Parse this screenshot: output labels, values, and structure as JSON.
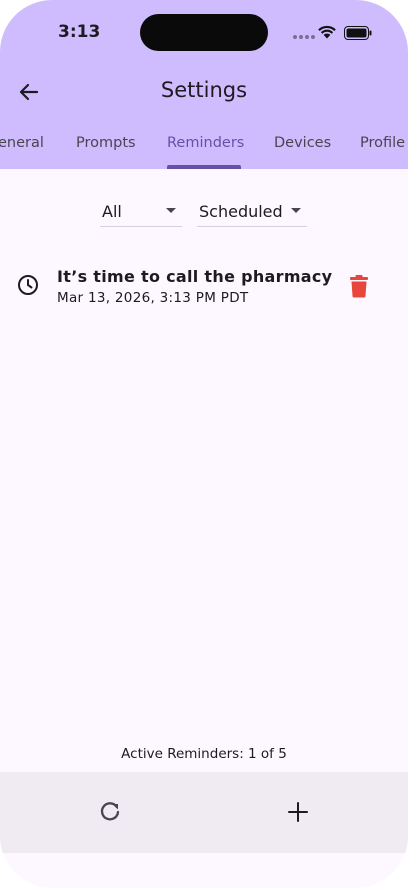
{
  "status_bar": {
    "time": "3:13"
  },
  "header": {
    "title": "Settings"
  },
  "tabs": [
    {
      "label": "eneral"
    },
    {
      "label": "Prompts"
    },
    {
      "label": "Reminders",
      "active": true
    },
    {
      "label": "Devices"
    },
    {
      "label": "Profile"
    }
  ],
  "filters": {
    "category": "All",
    "status": "Scheduled"
  },
  "reminders": [
    {
      "title": "It’s time to call the pharmacy",
      "datetime": "Mar 13, 2026, 3:13 PM PDT"
    }
  ],
  "footer": {
    "active_count": "Active Reminders: 1 of 5"
  },
  "colors": {
    "header_bg": "#cfbcff",
    "accent": "#6750a4",
    "body_bg": "#fdf7ff",
    "bottom_bar_bg": "#f0ebf3",
    "delete": "#e8453c"
  },
  "icons": {
    "back": "arrow-back-icon",
    "clock": "clock-icon",
    "delete": "trash-icon",
    "refresh": "refresh-icon",
    "add": "plus-icon",
    "wifi": "wifi-icon",
    "battery": "battery-icon"
  }
}
